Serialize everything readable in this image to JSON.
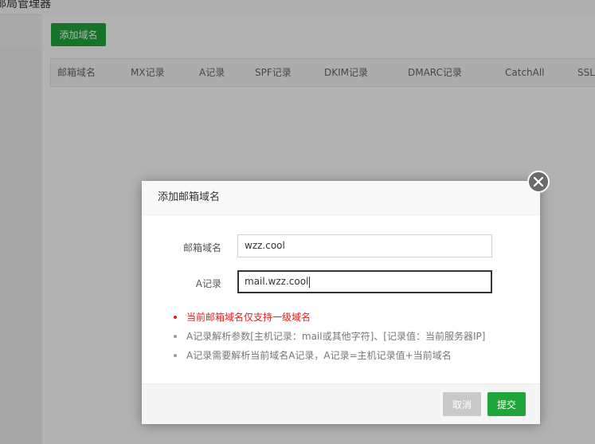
{
  "page": {
    "title": "邮局管理器"
  },
  "toolbar": {
    "add_domain_label": "添加域名"
  },
  "table": {
    "columns": [
      "邮箱域名",
      "MX记录",
      "A记录",
      "SPF记录",
      "DKIM记录",
      "DMARC记录",
      "CatchAll",
      "SSL"
    ]
  },
  "dialog": {
    "title": "添加邮箱域名",
    "fields": {
      "domain": {
        "label": "邮箱域名",
        "value": "wzz.cool"
      },
      "a_record": {
        "label": "A记录",
        "value": "mail.wzz.cool"
      }
    },
    "tips": [
      "当前邮箱域名仅支持一级域名",
      "A记录解析参数[主机记录：mail或其他字符]、[记录值：当前服务器IP]",
      "A记录需要解析当前域名A记录，A记录=主机记录值+当前域名"
    ],
    "cancel_label": "取消",
    "submit_label": "提交"
  },
  "colors": {
    "primary": "#20a53a",
    "warning": "#e02020",
    "disabled": "#c9c9c9"
  },
  "icons": {
    "close": "close-icon"
  }
}
